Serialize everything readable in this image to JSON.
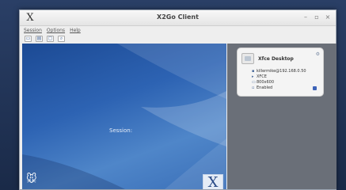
{
  "window": {
    "title": "X2Go Client",
    "app_icon_glyph": "X",
    "controls": {
      "minimize": "–",
      "maximize": "▫",
      "close": "×"
    }
  },
  "menubar": {
    "items": [
      {
        "label": "Session"
      },
      {
        "label": "Options"
      },
      {
        "label": "Help"
      }
    ]
  },
  "toolbar": {
    "icons": [
      {
        "name": "new-session-icon",
        "glyph": "▭"
      },
      {
        "name": "session-management-icon",
        "glyph": "▤"
      },
      {
        "name": "settings-icon",
        "glyph": "▢"
      },
      {
        "name": "search-icon",
        "glyph": "⌕"
      }
    ]
  },
  "session_panel": {
    "label": "Session:",
    "logo_glyph": "X",
    "mascot_glyph": "🐭"
  },
  "session_card": {
    "name": "Xfce Desktop",
    "server": "killermike@192.168.0.50",
    "type": "XFCE",
    "resolution": "800x600",
    "status": "Enabled"
  },
  "colors": {
    "panel_blue": "#2d63b3",
    "right_panel_gray": "#6a6f78",
    "card_bg": "#f4f4f4"
  }
}
